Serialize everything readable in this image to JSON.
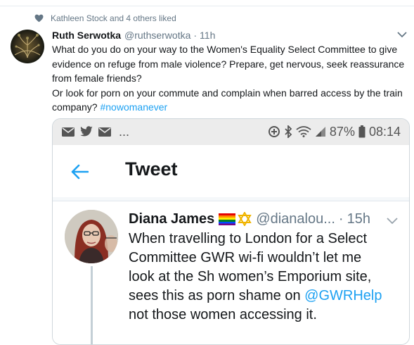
{
  "social_context": {
    "text": "Kathleen Stock and 4 others liked"
  },
  "tweet": {
    "author_name": "Ruth Serwotka",
    "author_handle": "@ruthserwotka",
    "separator": "·",
    "timestamp": "11h",
    "paragraph1": "What do you do on your way to the Women's Equality Select Committee  to give evidence on refuge from male violence? Prepare, get nervous, seek reassurance from female friends?",
    "paragraph2_text": "Or look for porn on your commute and complain when barred access by the train company? ",
    "hashtag": "#nowomanever"
  },
  "screenshot": {
    "status_bar": {
      "ellipsis": "...",
      "battery_percent": "87%",
      "time": "08:14"
    },
    "app_bar": {
      "title": "Tweet"
    },
    "embedded_tweet": {
      "author_name": "Diana James",
      "author_handle": "@dianalou...",
      "separator": "·",
      "timestamp": "15h",
      "line1": "When travelling to London for a Select",
      "line2": "Committee GWR wi-fi wouldn’t let me",
      "line3": "look at the Sh women’s Emporium site,",
      "line4_text": "sees this as porn shame on ",
      "line4_mention": "@GWRHelp",
      "line5": "not those women accessing it."
    }
  },
  "colors": {
    "link": "#1da1f2",
    "muted": "#657786",
    "text": "#14171a"
  },
  "icons": [
    "heart-icon",
    "chevron-down-icon",
    "mail-icon",
    "twitter-bird-icon",
    "data-saver-icon",
    "bluetooth-icon",
    "wifi-icon",
    "signal-icon",
    "battery-icon",
    "back-arrow-icon",
    "rainbow-flag-icon",
    "star-of-david-icon"
  ]
}
